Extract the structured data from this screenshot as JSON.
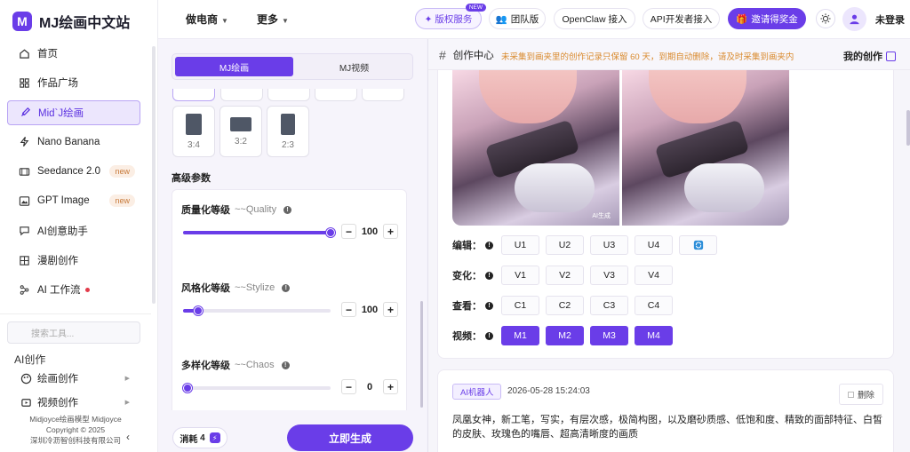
{
  "brand": {
    "logo_letter": "M",
    "name": "MJ绘画中文站"
  },
  "nav": [
    {
      "label": "首页",
      "icon": "home-icon"
    },
    {
      "label": "作品广场",
      "icon": "grid-icon"
    },
    {
      "label": "Mid`J绘画",
      "icon": "brush-icon",
      "active": true
    },
    {
      "label": "Nano Banana",
      "icon": "lightning-icon"
    },
    {
      "label": "Seedance 2.0",
      "icon": "video-icon",
      "badge": "new"
    },
    {
      "label": "GPT Image",
      "icon": "image-icon",
      "badge": "new"
    },
    {
      "label": "AI创意助手",
      "icon": "chat-icon"
    },
    {
      "label": "漫剧创作",
      "icon": "layout-icon"
    },
    {
      "label": "AI 工作流",
      "icon": "network-icon",
      "dot": true
    }
  ],
  "tool_search": {
    "placeholder": "搜索工具..."
  },
  "ai_section": {
    "title": "AI创作",
    "items": [
      {
        "label": "绘画创作",
        "icon": "palette-icon"
      },
      {
        "label": "视频创作",
        "icon": "film-icon"
      }
    ]
  },
  "footer": {
    "line1": "Midjoyce绘画模型 Midjoyce",
    "line2": "Copyright © 2025",
    "line3": "深圳冷沥智创科技有限公司"
  },
  "topbar": {
    "menu1": "做电商",
    "menu2": "更多",
    "vip": "✦ 版权服务",
    "vip_tag": "NEW",
    "team": "团队版",
    "openclaw": "OpenClaw 接入",
    "api": "API开发者接入",
    "invite": "邀请得奖金",
    "login": "未登录"
  },
  "panel": {
    "tab_active": "MJ绘画",
    "tab_inactive": "MJ视频",
    "ratios": [
      {
        "label": "3:4"
      },
      {
        "label": "3:2"
      },
      {
        "label": "2:3"
      }
    ],
    "advanced_title": "高级参数",
    "params": [
      {
        "label": "质量化等级",
        "en": "~~Quality",
        "value": "100",
        "fraction": 1.0
      },
      {
        "label": "风格化等级",
        "en": "~~Stylize",
        "value": "100",
        "fraction": 0.1
      },
      {
        "label": "多样化等级",
        "en": "~~Chaos",
        "value": "0",
        "fraction": 0.0
      }
    ],
    "cost_label": "消耗",
    "cost_value": "4",
    "generate": "立即生成"
  },
  "main": {
    "title": "创作中心",
    "note": "未采集到画夹里的创作记录只保留 60 天，到期自动删除，请及时采集到画夹内",
    "mine": "我的创作",
    "watermark": "AI生成",
    "rows": [
      {
        "label": "编辑：",
        "buttons": [
          "U1",
          "U2",
          "U3",
          "U4"
        ],
        "refresh": true
      },
      {
        "label": "变化：",
        "buttons": [
          "V1",
          "V2",
          "V3",
          "V4"
        ]
      },
      {
        "label": "查看：",
        "buttons": [
          "C1",
          "C2",
          "C3",
          "C4"
        ]
      },
      {
        "label": "视频：",
        "buttons": [
          "M1",
          "M2",
          "M3",
          "M4"
        ],
        "highlight": true
      }
    ],
    "record": {
      "tag": "AI机器人",
      "timestamp": "2026-05-28 15:24:03",
      "delete": "删除",
      "prompt": "凤凰女神，新工笔，写实，有层次感，极简构图，以及磨砂质感、低饱和度、精致的面部特征、白皙的皮肤、玫瑰色的嘴唇、超高清晰度的画质"
    }
  },
  "colors": {
    "accent": "#6a3de8",
    "note": "#d98a2e",
    "badge": "#c77a3a"
  }
}
